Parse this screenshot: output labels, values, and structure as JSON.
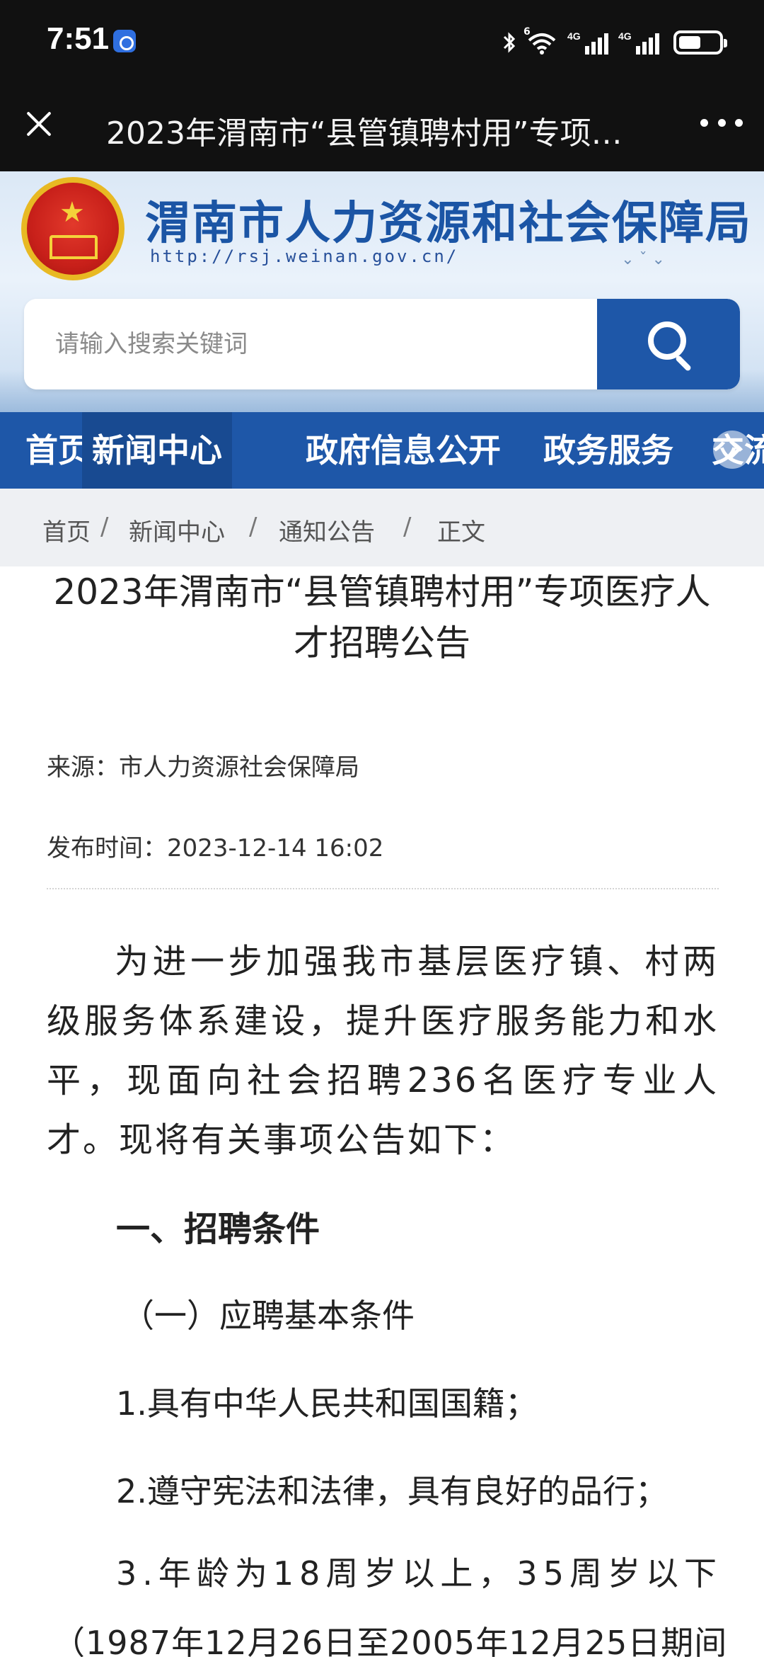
{
  "status_bar": {
    "time": "7:51",
    "network_1": "4G",
    "network_2": "4G",
    "wifi_badge": "6",
    "battery_level": 0.56
  },
  "browser": {
    "title": "2023年渭南市“县管镇聘村用”专项医疗人才招聘公告"
  },
  "site": {
    "name": "渭南市人力资源和社会保障局",
    "url": "http://rsj.weinan.gov.cn/",
    "search_placeholder": "请输入搜索关键词"
  },
  "nav": {
    "items": [
      "首页",
      "新闻中心",
      "政府信息公开",
      "政务服务",
      "交流"
    ],
    "active": "新闻中心"
  },
  "breadcrumb": [
    "首页",
    "新闻中心",
    "通知公告",
    "正文"
  ],
  "article": {
    "title": "2023年渭南市“县管镇聘村用”专项医疗人才招聘公告",
    "source": "来源：市人力资源社会保障局",
    "time": "发布时间：2023-12-14 16:02",
    "intro": "为进一步加强我市基层医疗镇、村两级服务体系建设，提升医疗服务能力和水平，现面向社会招聘236名医疗专业人才。现将有关事项公告如下：",
    "section1": "一、招聘条件",
    "subsection1": "（一）应聘基本条件",
    "item1": "1.具有中华人民共和国国籍；",
    "item2": "2.遵守宪法和法律，具有良好的品行；",
    "item3": "3.年龄为18周岁以上，35周岁以下",
    "item3_cont": "（1987年12月26日至2005年12月25日期间"
  }
}
